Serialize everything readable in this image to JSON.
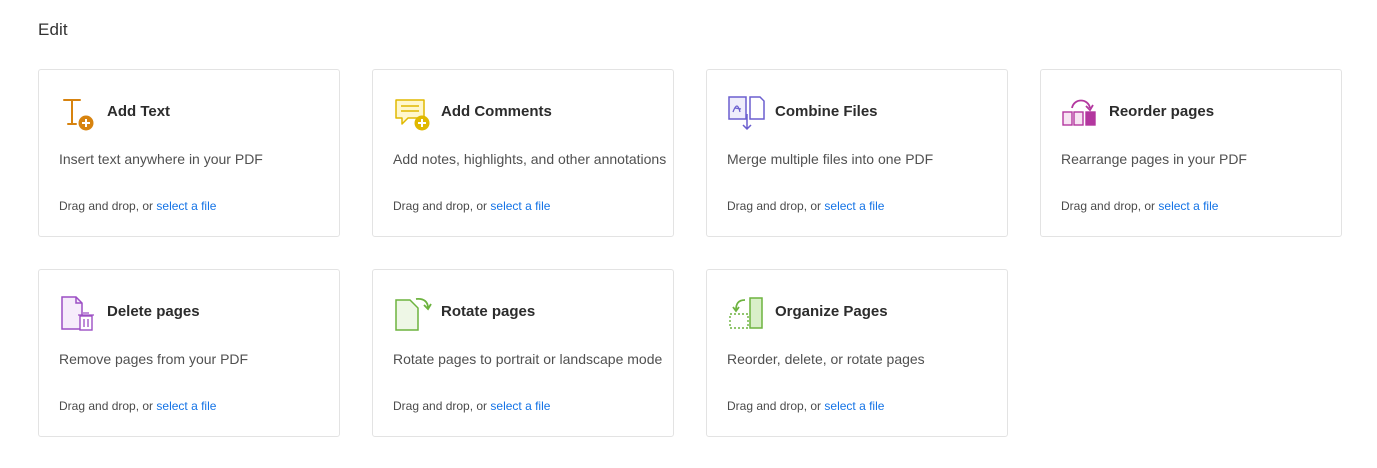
{
  "section": {
    "title": "Edit"
  },
  "cards": [
    {
      "title": "Add Text",
      "description": "Insert text anywhere in your PDF",
      "drop_text": "Drag and drop, or ",
      "link": "select a file",
      "icon": "add-text-icon",
      "color": "#d7830f"
    },
    {
      "title": "Add Comments",
      "description": "Add notes, highlights, and other annotations",
      "drop_text": "Drag and drop, or ",
      "link": "select a file",
      "icon": "add-comments-icon",
      "color": "#e0b900"
    },
    {
      "title": "Combine Files",
      "description": "Merge multiple files into one PDF",
      "drop_text": "Drag and drop, or ",
      "link": "select a file",
      "icon": "combine-files-icon",
      "color": "#6b5fcf"
    },
    {
      "title": "Reorder pages",
      "description": "Rearrange pages in your PDF",
      "drop_text": "Drag and drop, or ",
      "link": "select a file",
      "icon": "reorder-pages-icon",
      "color": "#b3379f"
    },
    {
      "title": "Delete pages",
      "description": "Remove pages from your PDF",
      "drop_text": "Drag and drop, or ",
      "link": "select a file",
      "icon": "delete-pages-icon",
      "color": "#9c4fc4"
    },
    {
      "title": "Rotate pages",
      "description": "Rotate pages to portrait or landscape mode",
      "drop_text": "Drag and drop, or ",
      "link": "select a file",
      "icon": "rotate-pages-icon",
      "color": "#6db33f"
    },
    {
      "title": "Organize Pages",
      "description": "Reorder, delete, or rotate pages",
      "drop_text": "Drag and drop, or ",
      "link": "select a file",
      "icon": "organize-pages-icon",
      "color": "#6db33f"
    }
  ],
  "colors": {
    "link": "#1473e6",
    "border": "#e3e3e3"
  }
}
